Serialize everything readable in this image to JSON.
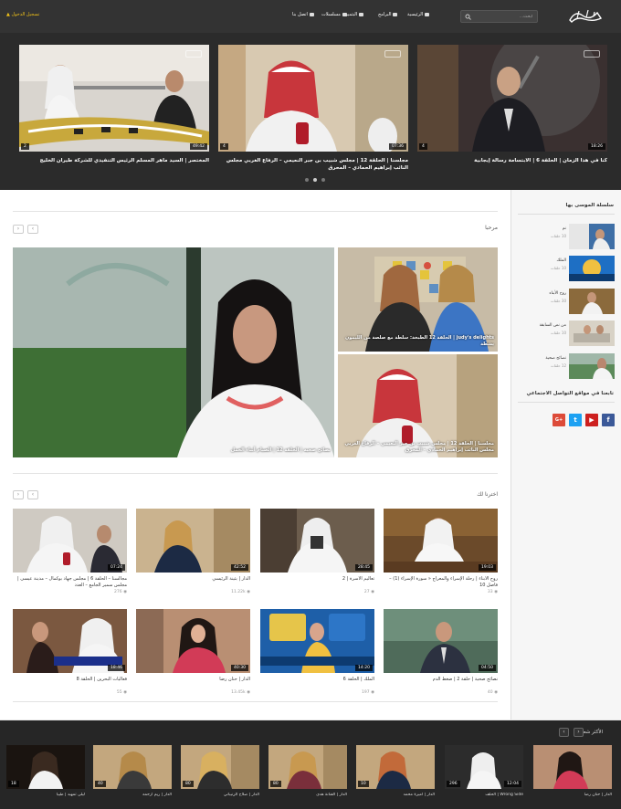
{
  "header": {
    "logo_text": "البحرين",
    "search_placeholder": "ابحث...",
    "nav": [
      {
        "label": "الرئيسية",
        "icon": "home-icon"
      },
      {
        "label": "البرامج",
        "icon": "tv-icon"
      },
      {
        "label": "البثمين",
        "icon": "film-icon"
      },
      {
        "label": "مسلسلات",
        "icon": "video-icon"
      },
      {
        "label": "اتصل بنا",
        "icon": "mail-icon"
      }
    ],
    "login_label": "تسجيل الدخول"
  },
  "hero": {
    "slides": [
      {
        "title": "كنا في هذا الزمان | الحلقة 6 | الابتسامة رسالة إيجابية",
        "duration": "18:26",
        "views": "4"
      },
      {
        "title": "مجلسنا | الحلقة 12 | مجلس شبيب بن جبر النعيمي – الرفاع الغربي مجلس النائب إبراهيم الحمادي – المحرق",
        "duration": "07:36",
        "views": "4"
      },
      {
        "title": "المختصر | السيد ماهر المسلم الرئيس التنفيذي للشركة طيران الخليج",
        "duration": "49:42",
        "views": "2"
      }
    ]
  },
  "welcome": {
    "title": "مرحبا",
    "featured": [
      {
        "caption": "نصائح صحية | الحلقة 12 | الصيام أثناء الحمل"
      },
      {
        "caption": "judy's delights | الحلقة 12 الطبخة: سلطة مع صلصة من الليمون يشطة"
      },
      {
        "caption": "مجلسنا | الحلقة 12 | مجلس شبيب بن جبر النعيمي – الرفاع الغربي مجلس النائب إبراهيم الحمادي – المحرق"
      }
    ]
  },
  "picks": {
    "title": "اخترنا لك",
    "cards": [
      {
        "title": "روح الأبناء | رحلة الإسراء والمعراج « سورة الإسراء (1) – فاصل 10",
        "duration": "19:03",
        "views": "33"
      },
      {
        "title": "تعاليم الأسرة | 2",
        "duration": "28:45",
        "views": "27"
      },
      {
        "title": "الدار | بثينة الرئيسي",
        "duration": "42:52",
        "views": "11.22k"
      },
      {
        "title": "مجالسنا – الحلقة 6 | مجلس جهاد بوكمال – مدينة عيسى | مجلس سمير الجامع – العدد",
        "duration": "07:24",
        "views": "276"
      },
      {
        "title": "نصائح صحية | حلقة 2 | ضغط الدم",
        "duration": "04:50",
        "views": "40"
      },
      {
        "title": "الملك | الحلقة 6",
        "duration": "14:20",
        "views": "197"
      },
      {
        "title": "الدار | حنان رضا",
        "duration": "40:30",
        "views": "13.45k"
      },
      {
        "title": "فعاليات البحرين | الحلقة 8",
        "duration": "18:46",
        "views": "55"
      }
    ]
  },
  "sidebar": {
    "series_title": "سلسلة الموسى بها",
    "series": [
      {
        "name": "نم",
        "count": "10 حلقات"
      },
      {
        "name": "الملك",
        "count": "10 حلقات"
      },
      {
        "name": "روح الأبناء",
        "count": "30 حلقات"
      },
      {
        "name": "من نص السابقة",
        "count": "10 حلقات"
      },
      {
        "name": "نصائح صحية",
        "count": "12 حلقات"
      }
    ],
    "social_title": "تابعنا في مواقع التواصل الاجتماعي",
    "social": [
      {
        "label": "f",
        "name": "facebook-icon",
        "color": "#3b5998"
      },
      {
        "label": "▶",
        "name": "youtube-icon",
        "color": "#cd201f"
      },
      {
        "label": "t",
        "name": "twitter-icon",
        "color": "#1da1f2"
      },
      {
        "label": "G+",
        "name": "googleplus-icon",
        "color": "#dd4b39"
      }
    ]
  },
  "popular": {
    "title": "الأكثر شعبية",
    "cards": [
      {
        "title": "الدار | حنان رضا",
        "duration": "",
        "views": ""
      },
      {
        "title": "Wrong Side | الحلف",
        "duration": "12:04",
        "views": "296"
      },
      {
        "title": "الدار | أميرة محمد",
        "duration": "",
        "views": "10"
      },
      {
        "title": "الدار | الفنانة هدى",
        "duration": "",
        "views": "80"
      },
      {
        "title": "الدار | صلاح الزنيباني",
        "duration": "",
        "views": "80"
      },
      {
        "title": "الدار | ريم ارحمه",
        "duration": "",
        "views": "40"
      },
      {
        "title": "ليلى تمهيد | طيبا",
        "duration": "",
        "views": "18"
      }
    ]
  },
  "colors": {
    "accent": "#f5c518",
    "header_bg": "#333333",
    "hero_bg": "#2b2b2b"
  }
}
